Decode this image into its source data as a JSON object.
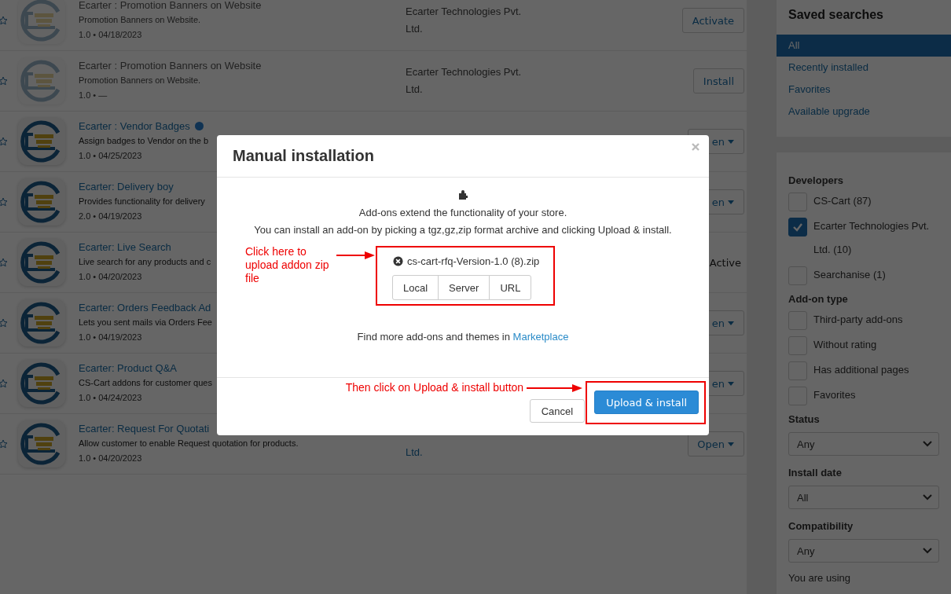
{
  "addons": [
    {
      "title": "Ecarter : Promotion Banners on Website",
      "verified": false,
      "description": "Promotion Banners on Website.",
      "meta": "1.0 • 04/18/2023",
      "disabled": true,
      "developer": "Ecarter Technologies Pvt. Ltd.",
      "action": {
        "kind": "button",
        "label": "Activate"
      }
    },
    {
      "title": "Ecarter : Promotion Banners on Website",
      "verified": false,
      "description": "Promotion Banners on Website.",
      "meta": "1.0 • —",
      "disabled": true,
      "developer": "Ecarter Technologies Pvt. Ltd.",
      "action": {
        "kind": "button",
        "label": "Install"
      }
    },
    {
      "title": "Ecarter : Vendor Badges",
      "verified": true,
      "description": "Assign badges to Vendor on the b",
      "meta": "1.0 • 04/25/2023",
      "disabled": false,
      "action": {
        "kind": "dropdown",
        "label": "en"
      }
    },
    {
      "title": "Ecarter: Delivery boy",
      "verified": false,
      "description": "Provides functionality for delivery",
      "meta": "2.0 • 04/19/2023",
      "disabled": false,
      "action": {
        "kind": "dropdown",
        "label": "en"
      }
    },
    {
      "title": "Ecarter: Live Search",
      "verified": false,
      "description": "Live search for any products and c",
      "meta": "1.0 • 04/20/2023",
      "disabled": false,
      "action": {
        "kind": "status",
        "label": "Active"
      }
    },
    {
      "title": "Ecarter: Orders Feedback Ad",
      "verified": false,
      "description": "Lets you sent mails via Orders Fee",
      "meta": "1.0 • 04/19/2023",
      "disabled": false,
      "action": {
        "kind": "dropdown",
        "label": "en"
      }
    },
    {
      "title": "Ecarter: Product Q&A",
      "verified": false,
      "description": "CS-Cart addons for customer ques",
      "meta": "1.0 • 04/24/2023",
      "disabled": false,
      "action": {
        "kind": "dropdown",
        "label": "en"
      }
    },
    {
      "title": "Ecarter: Request For Quotati",
      "verified": false,
      "description": "Allow customer to enable Request quotation for products.",
      "meta": "1.0 • 04/20/2023",
      "disabled": false,
      "developer": "Ltd.",
      "action": {
        "kind": "dropdown",
        "label": "Open"
      }
    }
  ],
  "sidebar": {
    "saved_searches": {
      "title": "Saved searches",
      "items": [
        {
          "label": "All",
          "selected": true
        },
        {
          "label": "Recently installed",
          "selected": false
        },
        {
          "label": "Favorites",
          "selected": false
        },
        {
          "label": "Available upgrade",
          "selected": false
        }
      ]
    },
    "filters": [
      {
        "kind": "checkboxes",
        "title": "Developers",
        "options": [
          {
            "label": "CS-Cart (87)",
            "checked": false
          },
          {
            "label": "Ecarter Technologies Pvt. Ltd. (10)",
            "checked": true
          },
          {
            "label": "Searchanise (1)",
            "checked": false
          }
        ]
      },
      {
        "kind": "checkboxes",
        "title": "Add-on type",
        "options": [
          {
            "label": "Third-party add-ons",
            "checked": false
          },
          {
            "label": "Without rating",
            "checked": false
          },
          {
            "label": "Has additional pages",
            "checked": false
          },
          {
            "label": "Favorites",
            "checked": false
          }
        ]
      },
      {
        "kind": "select",
        "title": "Status",
        "value": "Any"
      },
      {
        "kind": "select",
        "title": "Install date",
        "value": "All"
      },
      {
        "kind": "select",
        "title": "Compatibility",
        "value": "Any"
      }
    ],
    "note": "You are using"
  },
  "modal": {
    "title": "Manual installation",
    "intro": [
      "Add-ons extend the functionality of your store.",
      "You can install an add-on by picking a tgz,gz,zip format archive and clicking Upload & install."
    ],
    "file_hint": "Click here to upload addon zip file",
    "file_name": "cs-cart-rfq-Version-1.0 (8).zip",
    "sources": [
      "Local",
      "Server",
      "URL"
    ],
    "more_text": "Find more add-ons and themes in",
    "more_link": "Marketplace",
    "button_hint": "Then click on Upload & install button",
    "buttons": [
      {
        "kind": "secondary",
        "label": "Cancel"
      },
      {
        "kind": "primary",
        "label": "Upload & install"
      }
    ]
  }
}
